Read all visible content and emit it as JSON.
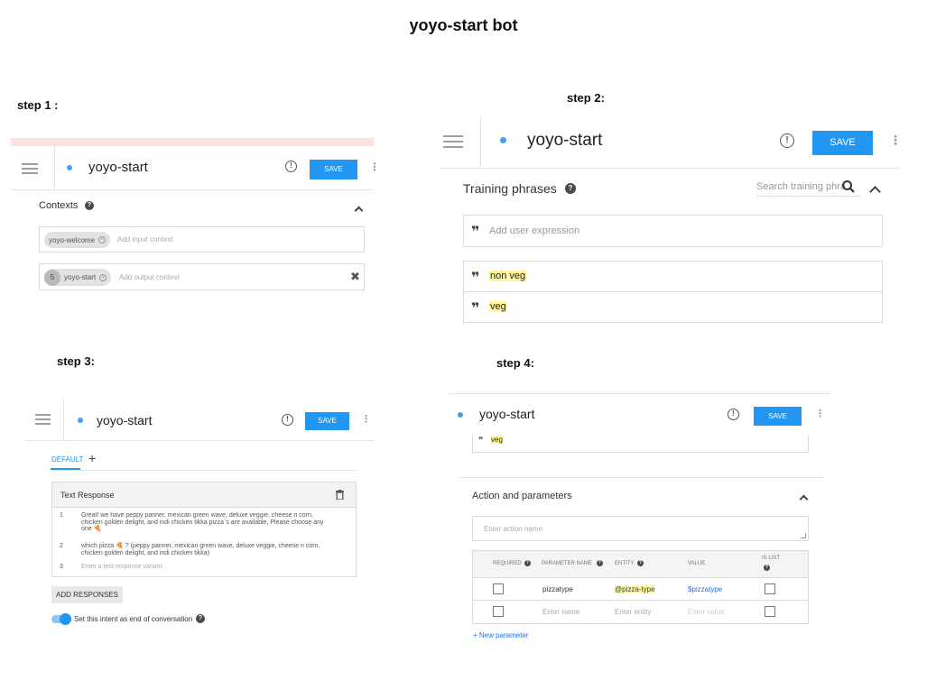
{
  "title": "yoyo-start bot",
  "intent_name": "yoyo-start",
  "save_label": "SAVE",
  "step1": {
    "label": "step 1 :",
    "contexts_title": "Contexts",
    "input_chip": "yoyo-welcome",
    "input_placeholder": "Add input context",
    "output_lifespan": "5",
    "output_chip": "yoyo-start",
    "output_placeholder": "Add output context"
  },
  "step2": {
    "label": "step 2:",
    "training_title": "Training phrases",
    "search_placeholder": "Search training phra",
    "add_placeholder": "Add user expression",
    "phrases": [
      "non veg",
      "veg"
    ]
  },
  "step3": {
    "label": "step 3:",
    "tab_default": "DEFAULT",
    "tab_add": "+",
    "text_response_title": "Text Response",
    "responses": [
      {
        "num": "1",
        "text": "Great! we have  peppy panner,  mexican green wave, deluxe veggie, cheese n corn, chicken golden delight, and indi chicken tikka  pizza`s are available, Please choose any one 🍕"
      },
      {
        "num": "2",
        "text": "which pizza 🍕 ?  (peppy panner,  mexican green wave, deluxe veggie, cheese n corn, chicken golden delight, and indi chicken tikka)"
      },
      {
        "num": "3",
        "text": "Enter a text response variant"
      }
    ],
    "add_responses": "ADD RESPONSES",
    "end_conversation": "Set this intent as end of conversation"
  },
  "step4": {
    "label": "step 4:",
    "prev_phrase": "veg",
    "action_title": "Action and parameters",
    "action_placeholder": "Enter action name",
    "headers": {
      "required": "REQUIRED",
      "param_name": "PARAMETER NAME",
      "entity": "ENTITY",
      "value": "VALUE",
      "is_list_1": "IS LIST"
    },
    "row1": {
      "name": "pizzatype",
      "entity": "@pizza-type",
      "value": "$pizzatype"
    },
    "row2": {
      "name": "Enter name",
      "entity": "Enter entity",
      "value": "Enter value"
    },
    "new_param": "+ New parameter"
  },
  "colors": {
    "accent": "#2196f3",
    "highlight": "#fff79a",
    "link": "#1a73e8"
  }
}
